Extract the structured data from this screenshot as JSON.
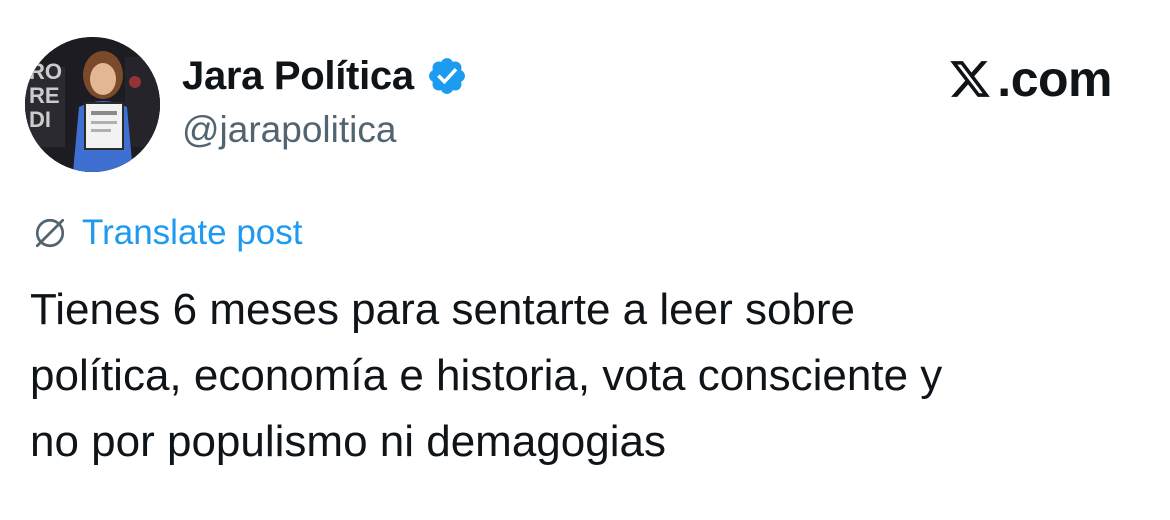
{
  "author": {
    "display_name": "Jara Política",
    "handle": "@jarapolitica",
    "verified_icon": "verified-badge-icon",
    "avatar_icon": "profile-photo"
  },
  "brand": {
    "logo_icon": "x-logo-icon",
    "text": ".com"
  },
  "translate": {
    "icon": "globe-icon",
    "label": "Translate post"
  },
  "tweet": {
    "text": "Tienes 6 meses para sentarte a leer sobre\npolítica, economía e historia, vota consciente y\nno por populismo ni demagogias"
  },
  "colors": {
    "text": "#0f1419",
    "secondary": "#536471",
    "link": "#1d9bf0",
    "verified": "#1d9bf0"
  }
}
